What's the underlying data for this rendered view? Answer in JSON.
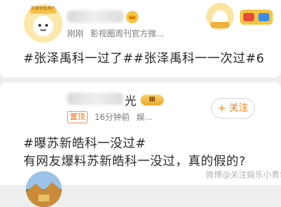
{
  "post1": {
    "time": "刚刚",
    "source": "影视圈周刊官方微...",
    "content": "#张泽禹科一过了##张泽禹科一一次过#6",
    "avatar_badge": "年度荣誉用户"
  },
  "post2": {
    "name_suffix": "光",
    "pin_label": "置顶",
    "time": "16分钟前",
    "source": "娱...",
    "vip_label": "Ⅲ",
    "follow_label": "+ 关注",
    "hashtag": "#曝苏新皓科一没过#",
    "content": "有网友爆料苏新皓科一没过，真的假的?"
  },
  "watermark": "微博@关注娱乐小青年",
  "colors": {
    "accent_orange": "#ff7a00",
    "text_dark": "#2b2b2b",
    "meta_gray": "#7a7a7a"
  }
}
